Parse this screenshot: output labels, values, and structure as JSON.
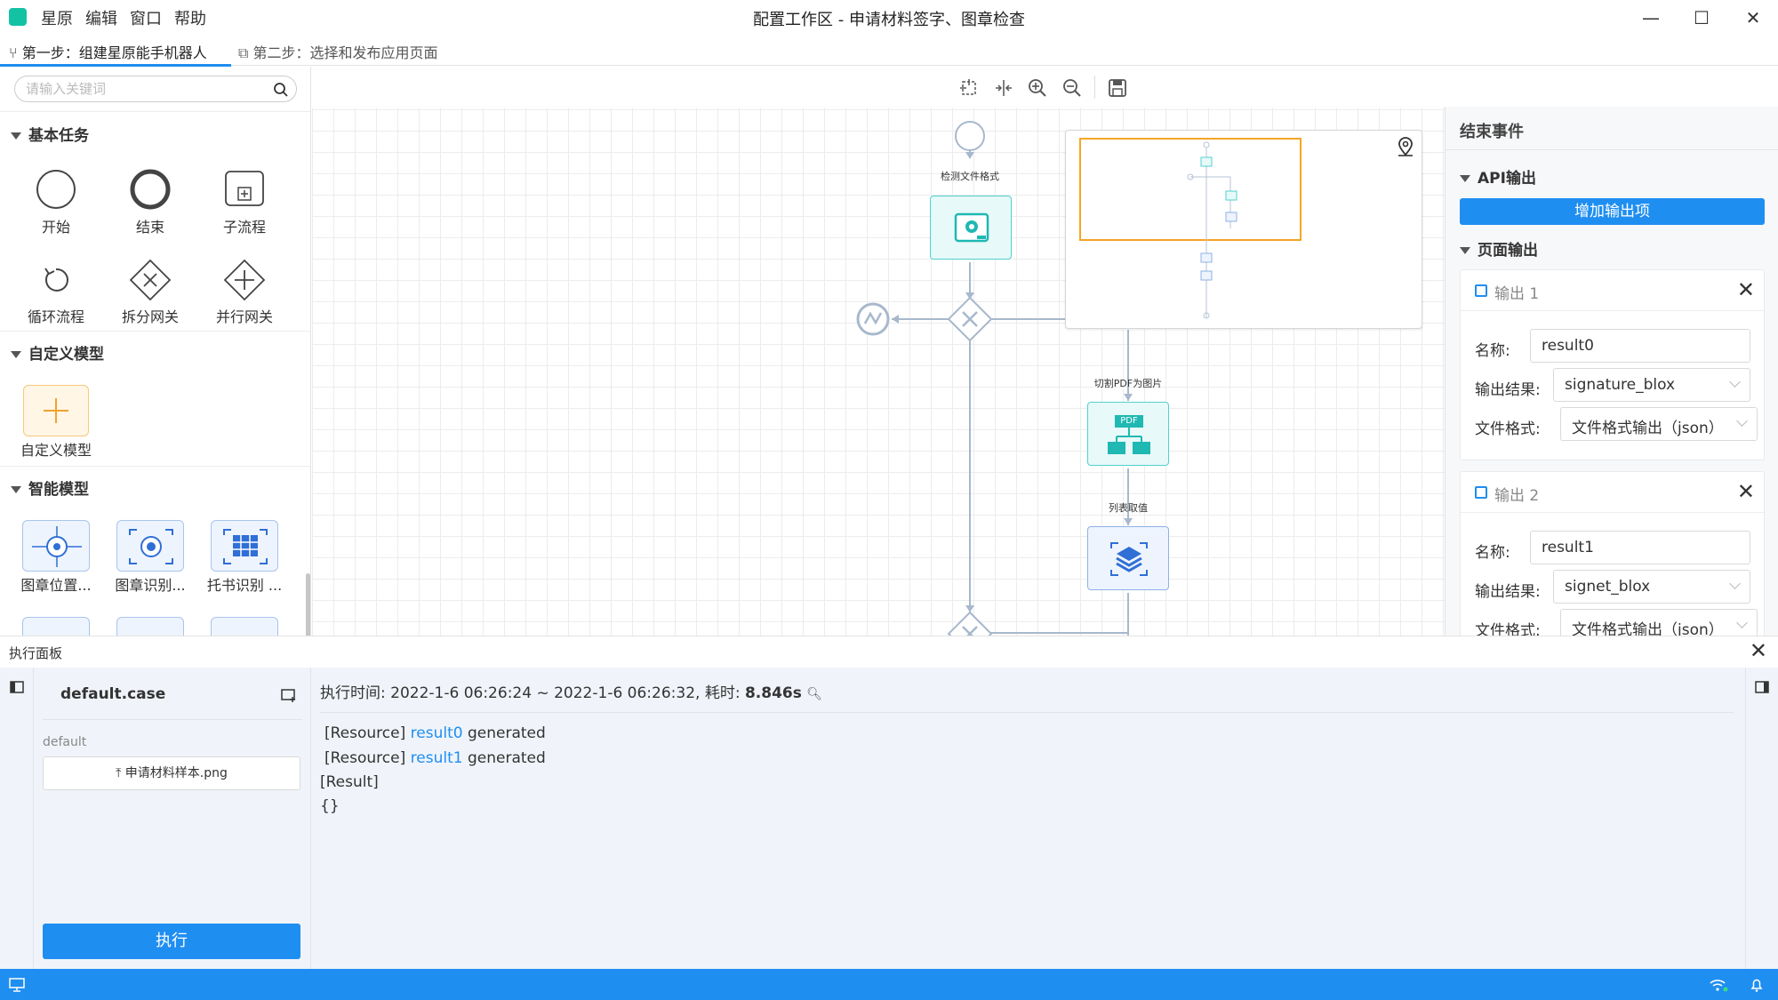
{
  "app": {
    "menu": [
      "星原",
      "编辑",
      "窗口",
      "帮助"
    ],
    "title": "配置工作区 - 申请材料签字、图章检查"
  },
  "steps": [
    {
      "label": "第一步：组建星原能手机器人",
      "active": true
    },
    {
      "label": "第二步：选择和发布应用页面",
      "active": false
    }
  ],
  "search": {
    "placeholder": "请输入关键词"
  },
  "palette": {
    "basic_title": "基本任务",
    "basic_items": [
      "开始",
      "结束",
      "子流程",
      "循环流程",
      "拆分网关",
      "并行网关"
    ],
    "custom_title": "自定义模型",
    "custom_items": [
      "自定义模型"
    ],
    "smart_title": "智能模型",
    "smart_items": [
      "图章位置...",
      "图章识别...",
      "托书识别 ..."
    ]
  },
  "flow": {
    "node_labels": [
      "检测文件格式",
      "切割PDF为图片",
      "列表取值"
    ],
    "pdf_badge": "PDF"
  },
  "properties": {
    "title": "结束事件",
    "api_section": "API输出",
    "add_button": "增加输出项",
    "page_section": "页面输出",
    "outputs": [
      {
        "title": "输出 1",
        "name_label": "名称:",
        "name": "result0",
        "result_label": "输出结果:",
        "result": "signature_blox",
        "format_label": "文件格式:",
        "format": "文件格式输出（json）"
      },
      {
        "title": "输出 2",
        "name_label": "名称:",
        "name": "result1",
        "result_label": "输出结果:",
        "result": "signet_blox",
        "format_label": "文件格式:",
        "format": "文件格式输出（json）"
      }
    ]
  },
  "exec_panel": {
    "title": "执行面板",
    "case_name": "default.case",
    "case_group": "default",
    "file_name": "申请材料样本.png",
    "run_button": "执行",
    "time_prefix": "执行时间: 2022-1-6 06:26:24 ~ 2022-1-6 06:26:32, 耗时: ",
    "duration": "8.846s",
    "log": [
      {
        "prefix": "[Resource] ",
        "link": "result0",
        "suffix": " generated"
      },
      {
        "prefix": "[Resource] ",
        "link": "result1",
        "suffix": " generated"
      }
    ],
    "result_label": "[Result]",
    "result_value": "{}"
  },
  "colors": {
    "accent": "#1f8ef1",
    "teal": "#13c2a3",
    "highlight": "#f5a623"
  }
}
